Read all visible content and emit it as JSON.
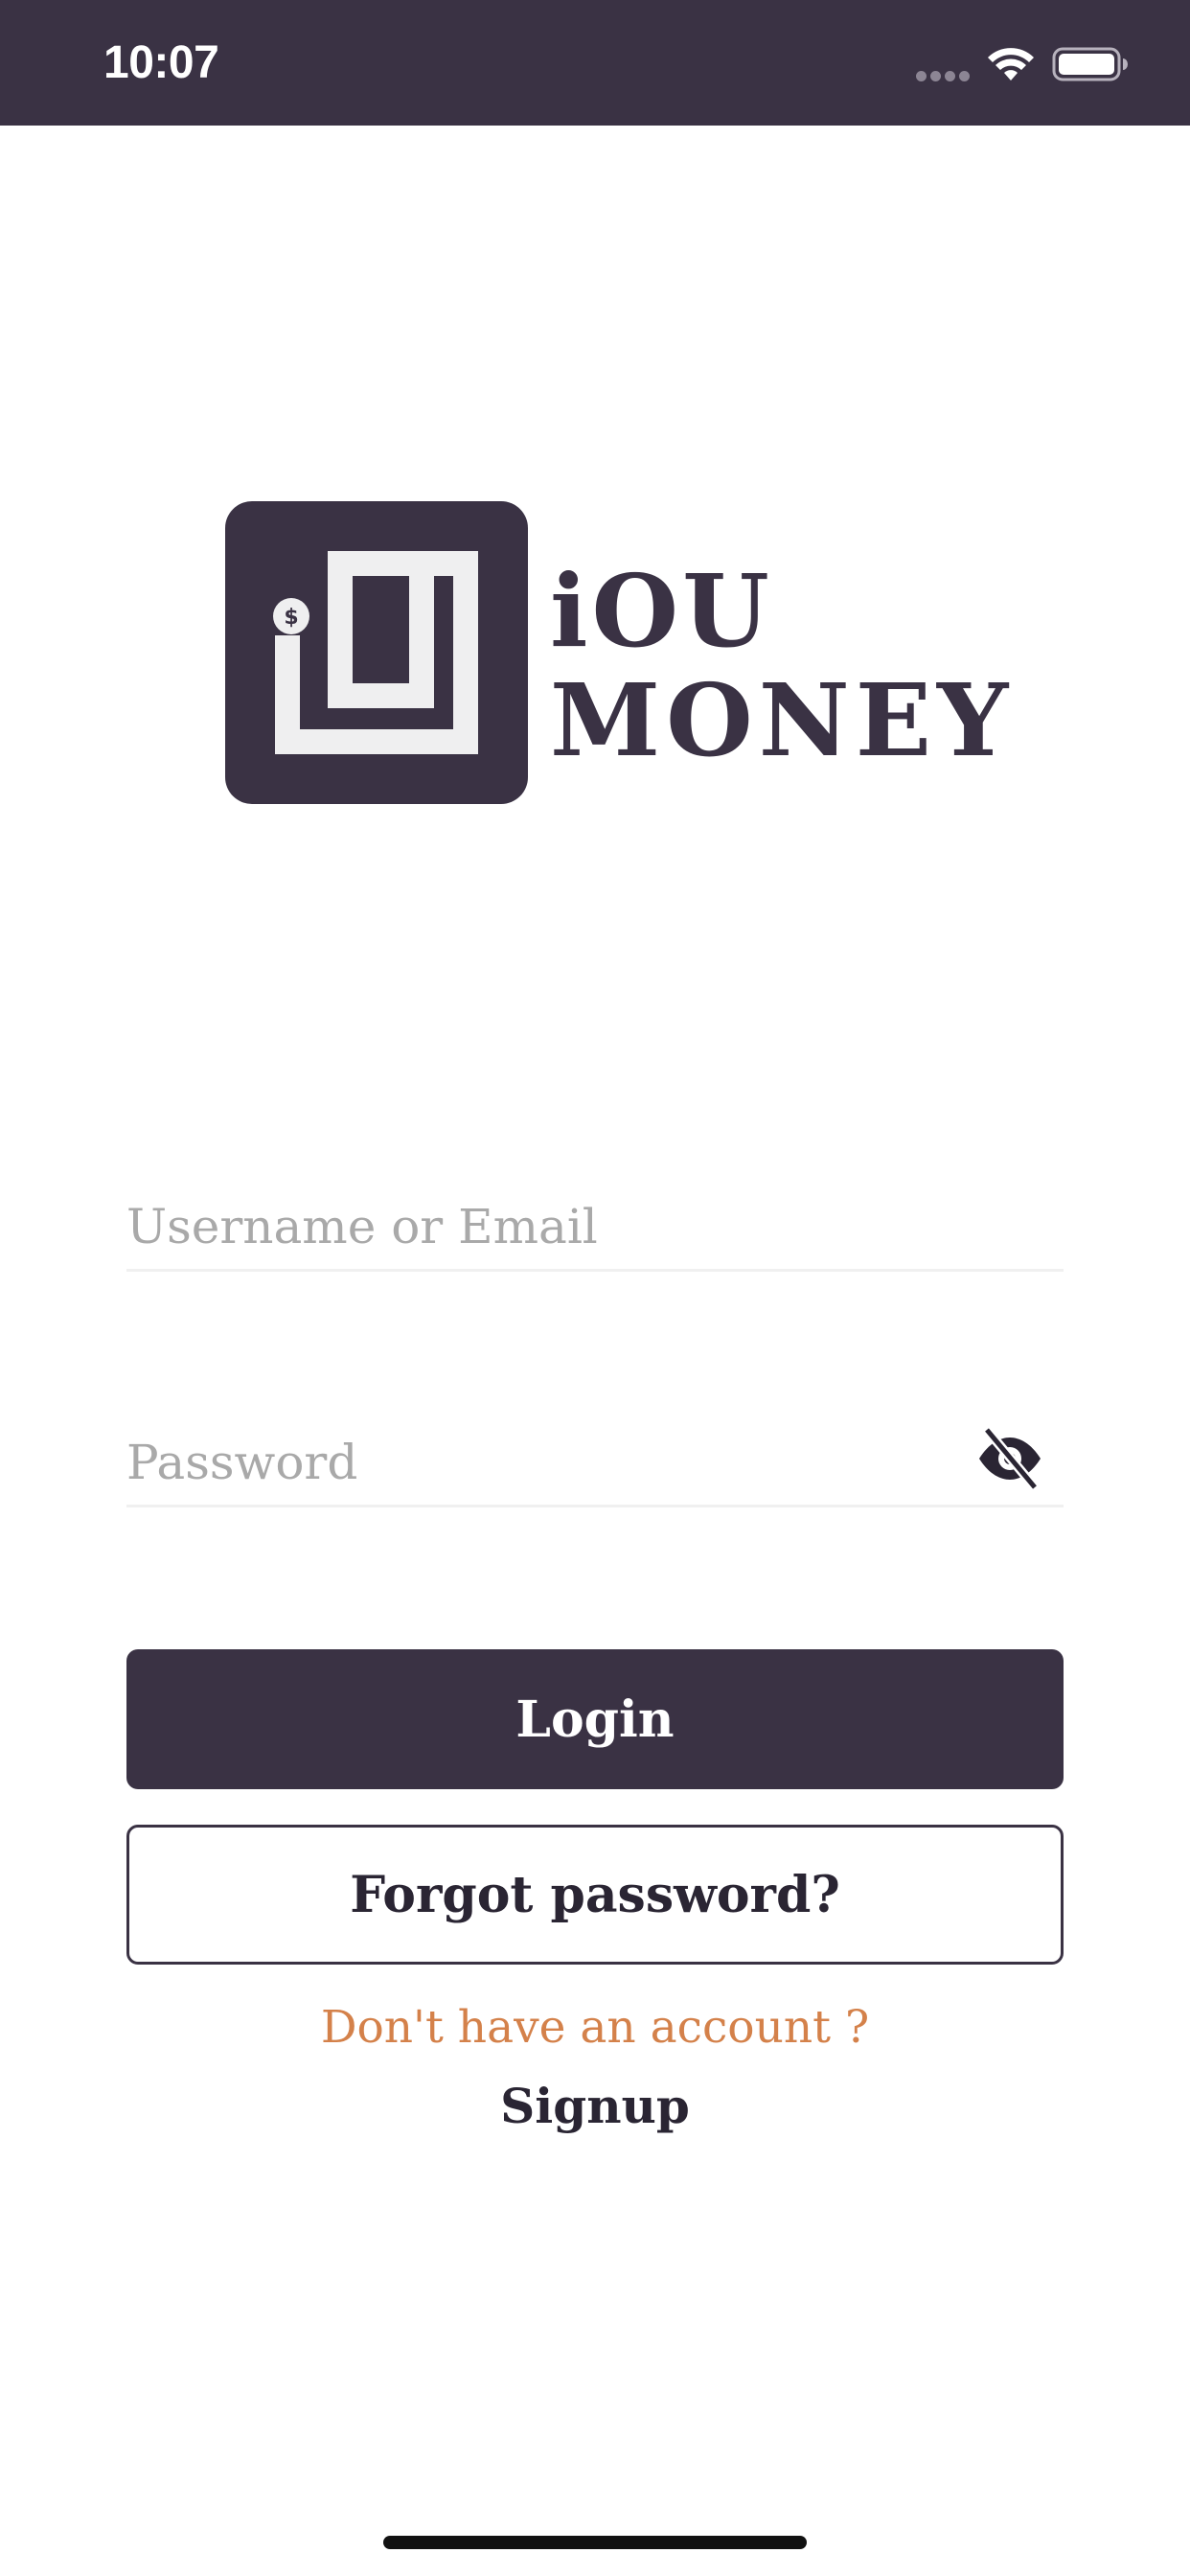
{
  "status_bar": {
    "time": "10:07",
    "background": "#3a3244",
    "icons": [
      "cellular-signal-icon",
      "wifi-icon",
      "battery-icon"
    ]
  },
  "brand": {
    "line1": "iOU",
    "line2": "MONEY",
    "logo_icon": "iou-money-logo",
    "logo_badge": "$",
    "color": "#3a3244"
  },
  "form": {
    "username_placeholder": "Username or Email",
    "username_value": "",
    "password_placeholder": "Password",
    "password_value": "",
    "password_toggle_icon": "eye-off-icon"
  },
  "actions": {
    "login_label": "Login",
    "forgot_label": "Forgot password?",
    "no_account_text": "Don't have an account ?",
    "signup_label": "Signup"
  },
  "colors": {
    "primary": "#3a3244",
    "accent": "#d4814a",
    "placeholder": "#a9a9a9"
  }
}
